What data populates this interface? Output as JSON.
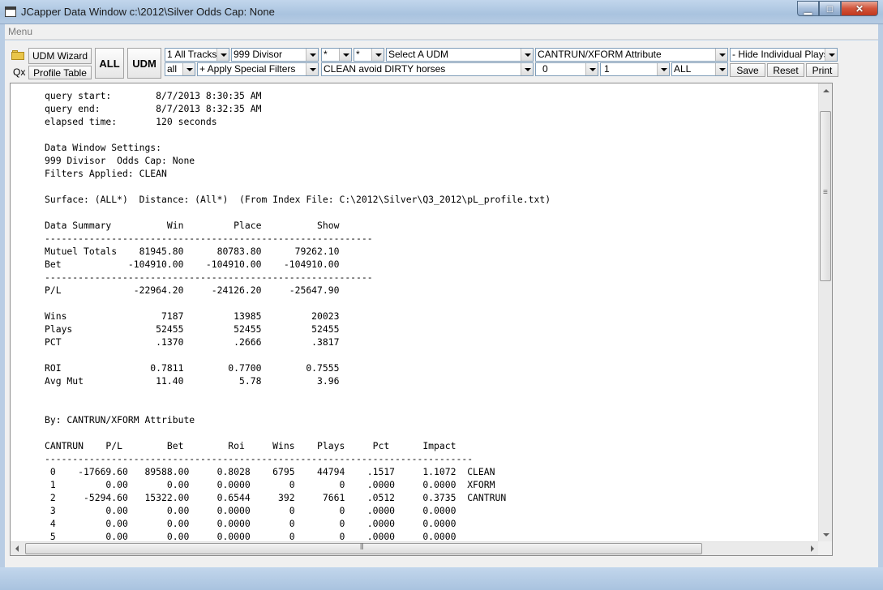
{
  "window": {
    "title": "JCapper Data Window c:\\2012\\Silver Odds Cap: None",
    "minimize": "▁",
    "maximize": "□",
    "close": "✕"
  },
  "menu": {
    "label": "Menu"
  },
  "toolbar": {
    "udm_wizard": "UDM Wizard",
    "qx": "Qx",
    "profile_table": "Profile Table",
    "all_button": "ALL",
    "udm_button": "UDM",
    "tracks": "1 All Tracks",
    "divisor": "999 Divisor",
    "star1": "*",
    "star2": "*",
    "select_udm": "Select A UDM",
    "attribute": "CANTRUN/XFORM Attribute",
    "hide_plays": "- Hide Individual Plays",
    "all_lower": "all",
    "special_filters": "+ Apply Special Filters",
    "clean_filter": "CLEAN avoid DIRTY horses",
    "zero": "0",
    "one": "1",
    "all_upper": "ALL",
    "save": "Save",
    "reset": "Reset",
    "print": "Print"
  },
  "report": {
    "lines": [
      "query start:        8/7/2013 8:30:35 AM",
      "query end:          8/7/2013 8:32:35 AM",
      "elapsed time:       120 seconds",
      "",
      "Data Window Settings:",
      "999 Divisor  Odds Cap: None",
      "Filters Applied: CLEAN",
      "",
      "Surface: (ALL*)  Distance: (All*)  (From Index File: C:\\2012\\Silver\\Q3_2012\\pL_profile.txt)",
      "",
      "Data Summary          Win         Place          Show",
      "-----------------------------------------------------------",
      "Mutuel Totals    81945.80      80783.80      79262.10",
      "Bet            -104910.00    -104910.00    -104910.00",
      "-----------------------------------------------------------",
      "P/L             -22964.20     -24126.20     -25647.90",
      "",
      "Wins                 7187         13985         20023",
      "Plays               52455         52455         52455",
      "PCT                 .1370         .2666         .3817",
      "",
      "ROI                0.7811        0.7700        0.7555",
      "Avg Mut             11.40          5.78          3.96",
      "",
      "",
      "By: CANTRUN/XFORM Attribute",
      "",
      "CANTRUN    P/L        Bet        Roi     Wins    Plays     Pct      Impact",
      "-----------------------------------------------------------------------------",
      " 0    -17669.60   89588.00     0.8028    6795    44794    .1517     1.1072  CLEAN",
      " 1         0.00       0.00     0.0000       0        0    .0000     0.0000  XFORM",
      " 2     -5294.60   15322.00     0.6544     392     7661    .0512     0.3735  CANTRUN",
      " 3         0.00       0.00     0.0000       0        0    .0000     0.0000",
      " 4         0.00       0.00     0.0000       0        0    .0000     0.0000",
      " 5         0.00       0.00     0.0000       0        0    .0000     0.0000"
    ]
  }
}
